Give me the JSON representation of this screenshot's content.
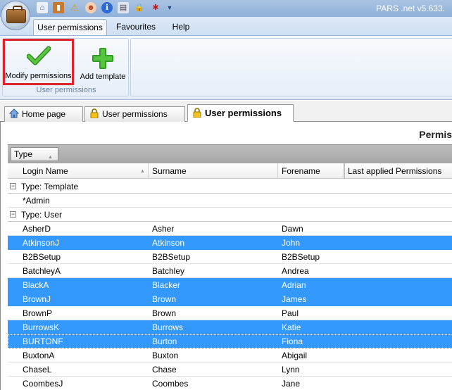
{
  "app": {
    "title": "PARS .net v5.633."
  },
  "quick_access": [
    "home-icon",
    "book-icon",
    "warning-icon",
    "user-icon",
    "info-icon",
    "print-icon",
    "lock-icon",
    "bug-icon",
    "dropdown-arrow-icon"
  ],
  "ribbon": {
    "tabs": [
      {
        "label": "User permissions",
        "active": true
      },
      {
        "label": "Favourites",
        "active": false
      },
      {
        "label": "Help",
        "active": false
      }
    ],
    "group_label": "User permissions",
    "buttons": {
      "modify": "Modify permissions",
      "add_template": "Add template"
    },
    "colors": {
      "highlight_border": "#e0242c",
      "check_green": "#3da52a",
      "plus_green": "#39b02a"
    }
  },
  "doc_tabs": [
    {
      "label": "Home page",
      "icon": "home-icon"
    },
    {
      "label": "User permissions",
      "icon": "lock-icon"
    },
    {
      "label": "User permissions",
      "icon": "lock-icon",
      "active": true
    }
  ],
  "content": {
    "heading": "Permis",
    "group_by_chip": "Type",
    "columns": [
      "Login Name",
      "Surname",
      "Forename",
      "Last applied Permissions"
    ],
    "groups": [
      {
        "label": "Type: Template",
        "rows": [
          {
            "login": "*Admin",
            "surname": "",
            "forename": "",
            "selected": false
          }
        ]
      },
      {
        "label": "Type: User",
        "rows": [
          {
            "login": "AsherD",
            "surname": "Asher",
            "forename": "Dawn",
            "selected": false
          },
          {
            "login": "AtkinsonJ",
            "surname": "Atkinson",
            "forename": "John",
            "selected": true
          },
          {
            "login": "B2BSetup",
            "surname": "B2BSetup",
            "forename": "B2BSetup",
            "selected": false
          },
          {
            "login": "BatchleyA",
            "surname": "Batchley",
            "forename": "Andrea",
            "selected": false
          },
          {
            "login": "BlackA",
            "surname": "Blacker",
            "forename": "Adrian",
            "selected": true
          },
          {
            "login": "BrownJ",
            "surname": "Brown",
            "forename": "James",
            "selected": true
          },
          {
            "login": "BrownP",
            "surname": "Brown",
            "forename": "Paul",
            "selected": false
          },
          {
            "login": "BurrowsK",
            "surname": "Burrows",
            "forename": "Katie",
            "selected": true
          },
          {
            "login": "BURTONF",
            "surname": "Burton",
            "forename": "Fiona",
            "selected": true
          },
          {
            "login": "BuxtonA",
            "surname": "Buxton",
            "forename": "Abigail",
            "selected": false
          },
          {
            "login": "ChaseL",
            "surname": "Chase",
            "forename": "Lynn",
            "selected": false
          },
          {
            "login": "CoombesJ",
            "surname": "Coombes",
            "forename": "Jane",
            "selected": false
          }
        ]
      }
    ],
    "colors": {
      "selection": "#3399ff"
    }
  }
}
